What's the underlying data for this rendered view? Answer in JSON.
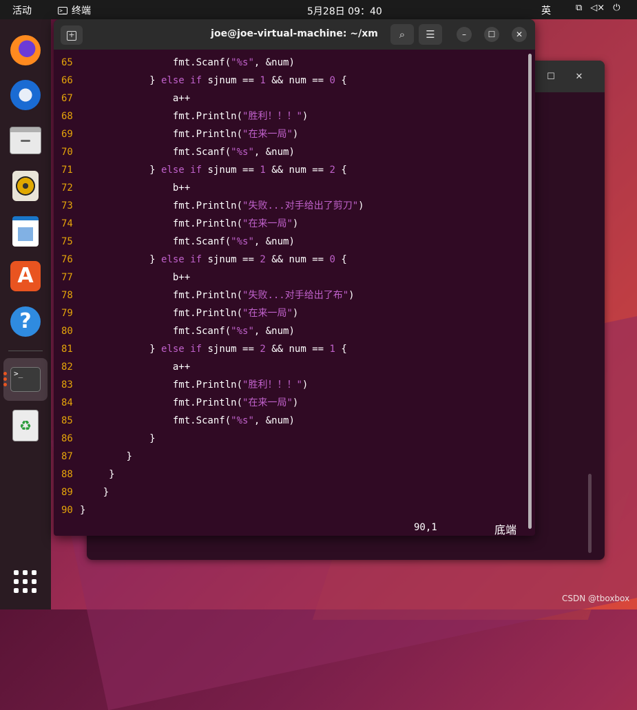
{
  "topbar": {
    "activities": "活动",
    "app_name": "终端",
    "clock": "5月28日  09：40",
    "input_method": "英",
    "network_icon": "network-icon",
    "volume_icon": "volume-muted-icon",
    "power_icon": "power-icon"
  },
  "dock": {
    "items": [
      "firefox-icon",
      "thunderbird-icon",
      "files-icon",
      "rhythmbox-icon",
      "libreoffice-writer-icon",
      "software-store-icon",
      "help-icon",
      "terminal-icon",
      "trash-icon",
      "show-apps-icon"
    ]
  },
  "terminal": {
    "title": "joe@joe-virtual-machine: ~/xm",
    "status_position": "90,1",
    "status_where": "底端"
  },
  "code_lines": [
    {
      "n": "65",
      "indent": "                ",
      "segs": [
        [
          "",
          "fmt.Scanf("
        ],
        [
          "s",
          "\"%s\""
        ],
        [
          "",
          ", &num)"
        ]
      ]
    },
    {
      "n": "66",
      "indent": "            ",
      "segs": [
        [
          "",
          "} "
        ],
        [
          "k",
          "else if"
        ],
        [
          "",
          " sjnum == "
        ],
        [
          "m",
          "1"
        ],
        [
          "",
          " && num == "
        ],
        [
          "m",
          "0"
        ],
        [
          "",
          " {"
        ]
      ]
    },
    {
      "n": "67",
      "indent": "                ",
      "segs": [
        [
          "",
          "a++"
        ]
      ]
    },
    {
      "n": "68",
      "indent": "                ",
      "segs": [
        [
          "",
          "fmt.Println("
        ],
        [
          "s",
          "\"胜利！！！\""
        ],
        [
          "",
          ")"
        ]
      ]
    },
    {
      "n": "69",
      "indent": "                ",
      "segs": [
        [
          "",
          "fmt.Println("
        ],
        [
          "s",
          "\"在来一局\""
        ],
        [
          "",
          ")"
        ]
      ]
    },
    {
      "n": "70",
      "indent": "                ",
      "segs": [
        [
          "",
          "fmt.Scanf("
        ],
        [
          "s",
          "\"%s\""
        ],
        [
          "",
          ", &num)"
        ]
      ]
    },
    {
      "n": "71",
      "indent": "            ",
      "segs": [
        [
          "",
          "} "
        ],
        [
          "k",
          "else if"
        ],
        [
          "",
          " sjnum == "
        ],
        [
          "m",
          "1"
        ],
        [
          "",
          " && num == "
        ],
        [
          "m",
          "2"
        ],
        [
          "",
          " {"
        ]
      ]
    },
    {
      "n": "72",
      "indent": "                ",
      "segs": [
        [
          "",
          "b++"
        ]
      ]
    },
    {
      "n": "73",
      "indent": "                ",
      "segs": [
        [
          "",
          "fmt.Println("
        ],
        [
          "s",
          "\"失败...对手给出了剪刀\""
        ],
        [
          "",
          ")"
        ]
      ]
    },
    {
      "n": "74",
      "indent": "                ",
      "segs": [
        [
          "",
          "fmt.Println("
        ],
        [
          "s",
          "\"在来一局\""
        ],
        [
          "",
          ")"
        ]
      ]
    },
    {
      "n": "75",
      "indent": "                ",
      "segs": [
        [
          "",
          "fmt.Scanf("
        ],
        [
          "s",
          "\"%s\""
        ],
        [
          "",
          ", &num)"
        ]
      ]
    },
    {
      "n": "76",
      "indent": "            ",
      "segs": [
        [
          "",
          "} "
        ],
        [
          "k",
          "else if"
        ],
        [
          "",
          " sjnum == "
        ],
        [
          "m",
          "2"
        ],
        [
          "",
          " && num == "
        ],
        [
          "m",
          "0"
        ],
        [
          "",
          " {"
        ]
      ]
    },
    {
      "n": "77",
      "indent": "                ",
      "segs": [
        [
          "",
          "b++"
        ]
      ]
    },
    {
      "n": "78",
      "indent": "                ",
      "segs": [
        [
          "",
          "fmt.Println("
        ],
        [
          "s",
          "\"失败...对手给出了布\""
        ],
        [
          "",
          ")"
        ]
      ]
    },
    {
      "n": "79",
      "indent": "                ",
      "segs": [
        [
          "",
          "fmt.Println("
        ],
        [
          "s",
          "\"在来一局\""
        ],
        [
          "",
          ")"
        ]
      ]
    },
    {
      "n": "80",
      "indent": "                ",
      "segs": [
        [
          "",
          "fmt.Scanf("
        ],
        [
          "s",
          "\"%s\""
        ],
        [
          "",
          ", &num)"
        ]
      ]
    },
    {
      "n": "81",
      "indent": "            ",
      "segs": [
        [
          "",
          "} "
        ],
        [
          "k",
          "else if"
        ],
        [
          "",
          " sjnum == "
        ],
        [
          "m",
          "2"
        ],
        [
          "",
          " && num == "
        ],
        [
          "m",
          "1"
        ],
        [
          "",
          " {"
        ]
      ]
    },
    {
      "n": "82",
      "indent": "                ",
      "segs": [
        [
          "",
          "a++"
        ]
      ]
    },
    {
      "n": "83",
      "indent": "                ",
      "segs": [
        [
          "",
          "fmt.Println("
        ],
        [
          "s",
          "\"胜利！！！\""
        ],
        [
          "",
          ")"
        ]
      ]
    },
    {
      "n": "84",
      "indent": "                ",
      "segs": [
        [
          "",
          "fmt.Println("
        ],
        [
          "s",
          "\"在来一局\""
        ],
        [
          "",
          ")"
        ]
      ]
    },
    {
      "n": "85",
      "indent": "                ",
      "segs": [
        [
          "",
          "fmt.Scanf("
        ],
        [
          "s",
          "\"%s\""
        ],
        [
          "",
          ", &num)"
        ]
      ]
    },
    {
      "n": "86",
      "indent": "            ",
      "segs": [
        [
          "",
          "}"
        ]
      ]
    },
    {
      "n": "87",
      "indent": "        ",
      "segs": [
        [
          "",
          "}"
        ]
      ]
    },
    {
      "n": "88",
      "indent": "     ",
      "segs": [
        [
          "",
          "}"
        ]
      ]
    },
    {
      "n": "89",
      "indent": "    ",
      "segs": [
        [
          "",
          "}"
        ]
      ]
    },
    {
      "n": "90",
      "indent": "",
      "segs": [
        [
          "",
          "}"
        ]
      ]
    }
  ],
  "watermark": "CSDN @tboxbox"
}
